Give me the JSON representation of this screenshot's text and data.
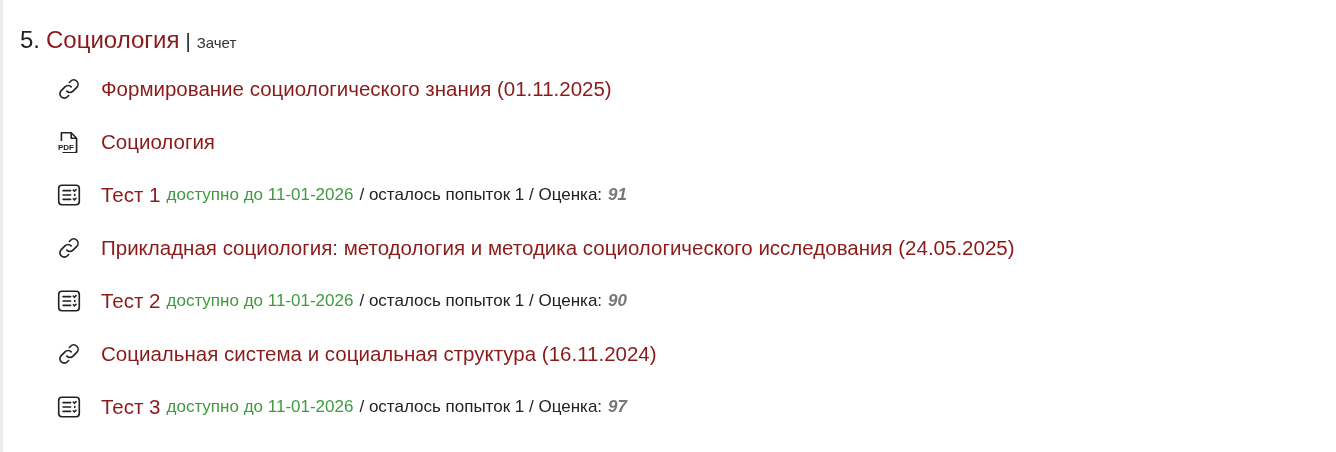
{
  "section": {
    "number": "5.",
    "title": "Социология",
    "separator": "|",
    "type": "Зачет"
  },
  "items": [
    {
      "kind": "link",
      "title": "Формирование социологического знания (01.11.2025)"
    },
    {
      "kind": "pdf",
      "title": "Социология",
      "icon_text": "PDF"
    },
    {
      "kind": "test",
      "title": "Тест 1",
      "availability": "доступно до 11-01-2026",
      "details": "/ осталось попыток 1 / Оценка:",
      "grade": "91"
    },
    {
      "kind": "link",
      "title": "Прикладная социология: методология и методика социологического исследования (24.05.2025)"
    },
    {
      "kind": "test",
      "title": "Тест 2",
      "availability": "доступно до 11-01-2026",
      "details": "/ осталось попыток 1 / Оценка:",
      "grade": "90"
    },
    {
      "kind": "link",
      "title": "Социальная система и социальная структура (16.11.2024)"
    },
    {
      "kind": "test",
      "title": "Тест 3",
      "availability": "доступно до 11-01-2026",
      "details": "/ осталось попыток 1 / Оценка:",
      "grade": "97"
    }
  ]
}
